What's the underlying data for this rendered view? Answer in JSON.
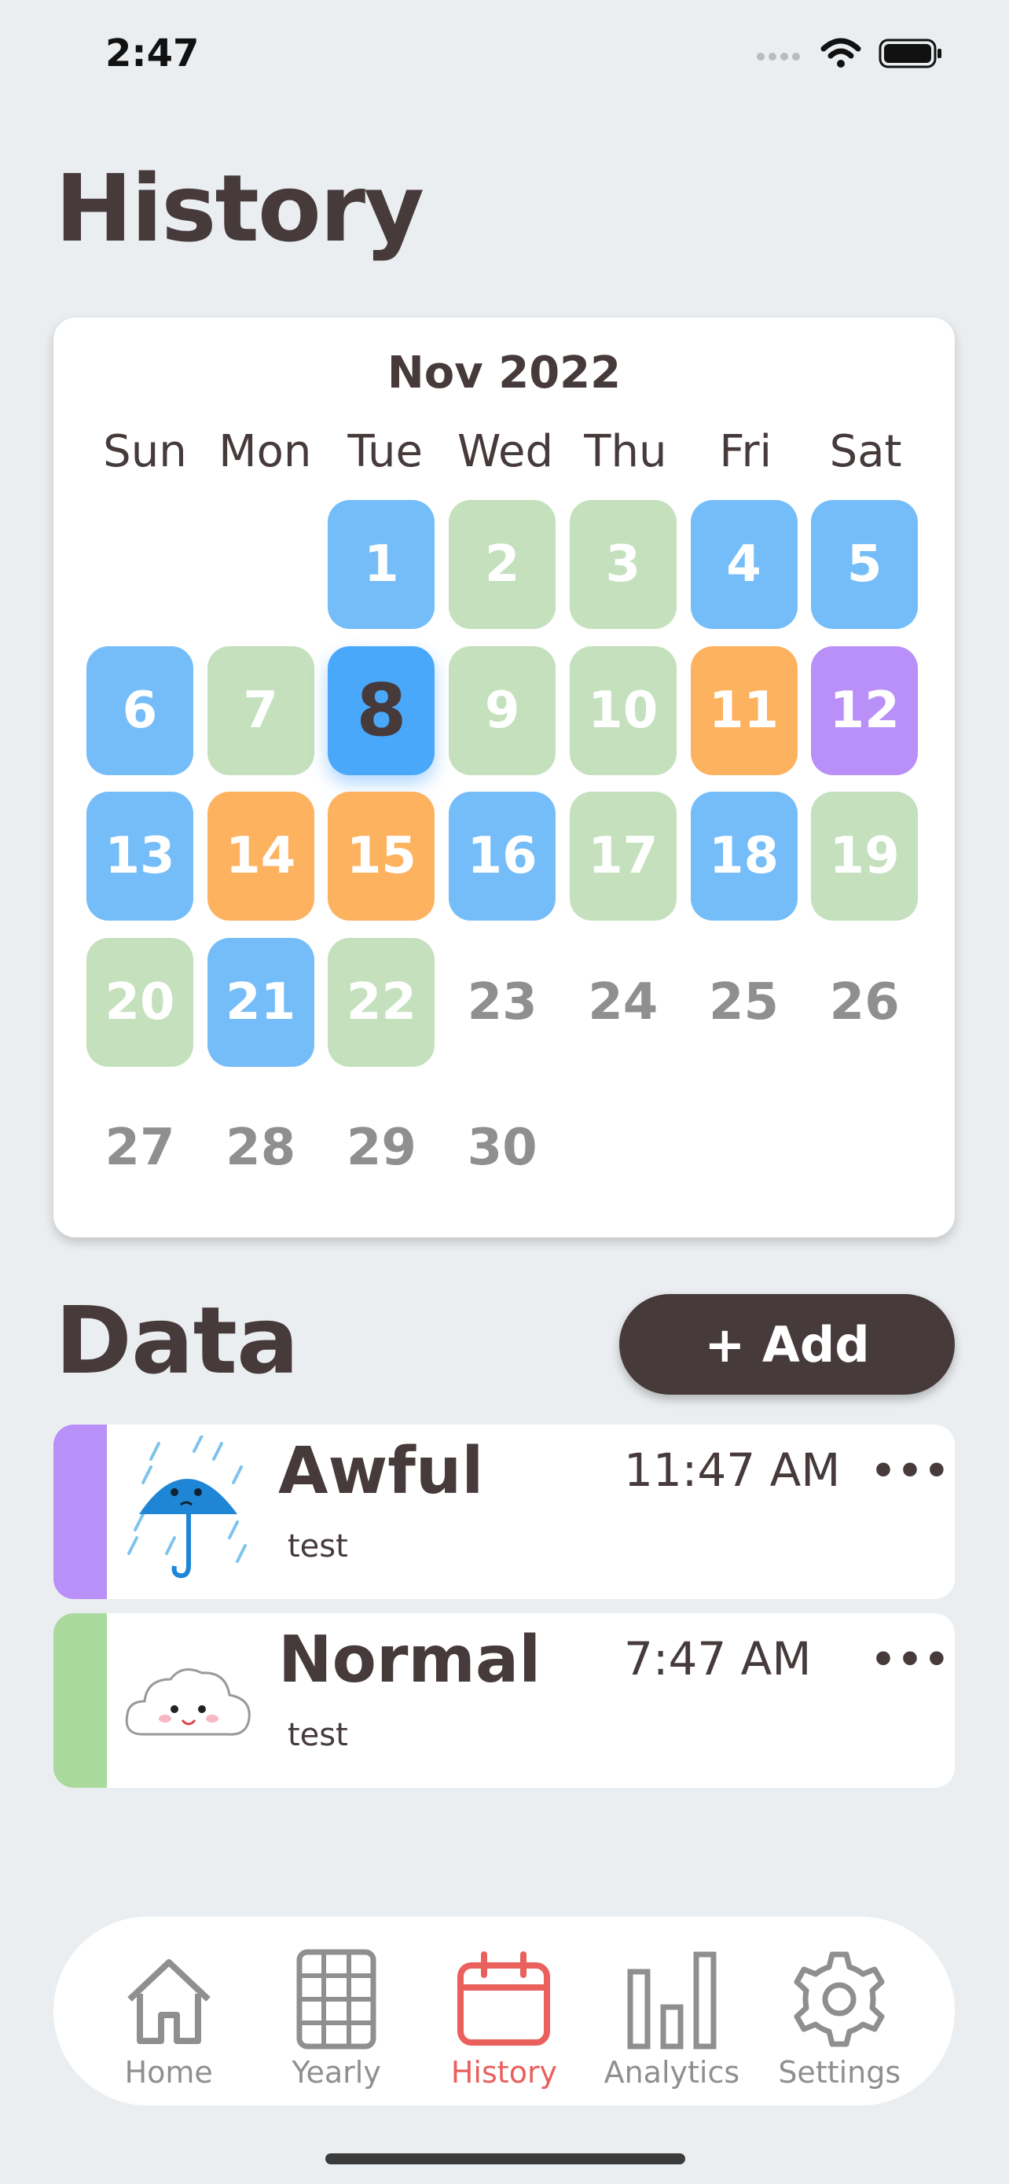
{
  "status_bar": {
    "time": "2:47"
  },
  "page": {
    "title": "History"
  },
  "calendar": {
    "month_label": "Nov 2022",
    "weekdays": [
      "Sun",
      "Mon",
      "Tue",
      "Wed",
      "Thu",
      "Fri",
      "Sat"
    ],
    "first_weekday_index": 2,
    "today": 8,
    "mood_colors": {
      "blue": "#75bdf8",
      "green": "#c4e0bc",
      "orange": "#fdb25f",
      "purple": "#b98ff8",
      "today": "#4aa8fb"
    },
    "days": [
      {
        "day": "1",
        "mood": "blue"
      },
      {
        "day": "2",
        "mood": "green"
      },
      {
        "day": "3",
        "mood": "green"
      },
      {
        "day": "4",
        "mood": "blue"
      },
      {
        "day": "5",
        "mood": "blue"
      },
      {
        "day": "6",
        "mood": "blue"
      },
      {
        "day": "7",
        "mood": "green"
      },
      {
        "day": "8",
        "mood": "today"
      },
      {
        "day": "9",
        "mood": "green"
      },
      {
        "day": "10",
        "mood": "green"
      },
      {
        "day": "11",
        "mood": "orange"
      },
      {
        "day": "12",
        "mood": "purple"
      },
      {
        "day": "13",
        "mood": "blue"
      },
      {
        "day": "14",
        "mood": "orange"
      },
      {
        "day": "15",
        "mood": "orange"
      },
      {
        "day": "16",
        "mood": "blue"
      },
      {
        "day": "17",
        "mood": "green"
      },
      {
        "day": "18",
        "mood": "blue"
      },
      {
        "day": "19",
        "mood": "green"
      },
      {
        "day": "20",
        "mood": "green"
      },
      {
        "day": "21",
        "mood": "blue"
      },
      {
        "day": "22",
        "mood": "green"
      },
      {
        "day": "23",
        "mood": null
      },
      {
        "day": "24",
        "mood": null
      },
      {
        "day": "25",
        "mood": null
      },
      {
        "day": "26",
        "mood": null
      },
      {
        "day": "27",
        "mood": null
      },
      {
        "day": "28",
        "mood": null
      },
      {
        "day": "29",
        "mood": null
      },
      {
        "day": "30",
        "mood": null
      }
    ]
  },
  "data_section": {
    "title": "Data",
    "add_label": "+ Add",
    "entries": [
      {
        "mood": "Awful",
        "time": "11:47 AM",
        "note": "test",
        "strip_color": "#b98ff8",
        "icon": "rain-umbrella-icon"
      },
      {
        "mood": "Normal",
        "time": "7:47 AM",
        "note": "test",
        "strip_color": "#a9d99d",
        "icon": "cloud-icon"
      }
    ]
  },
  "tab_bar": {
    "tabs": [
      {
        "label": "Home",
        "icon": "home-icon",
        "active": false
      },
      {
        "label": "Yearly",
        "icon": "grid-icon",
        "active": false
      },
      {
        "label": "History",
        "icon": "calendar-icon",
        "active": true
      },
      {
        "label": "Analytics",
        "icon": "bar-chart-icon",
        "active": false
      },
      {
        "label": "Settings",
        "icon": "gear-icon",
        "active": false
      }
    ]
  }
}
